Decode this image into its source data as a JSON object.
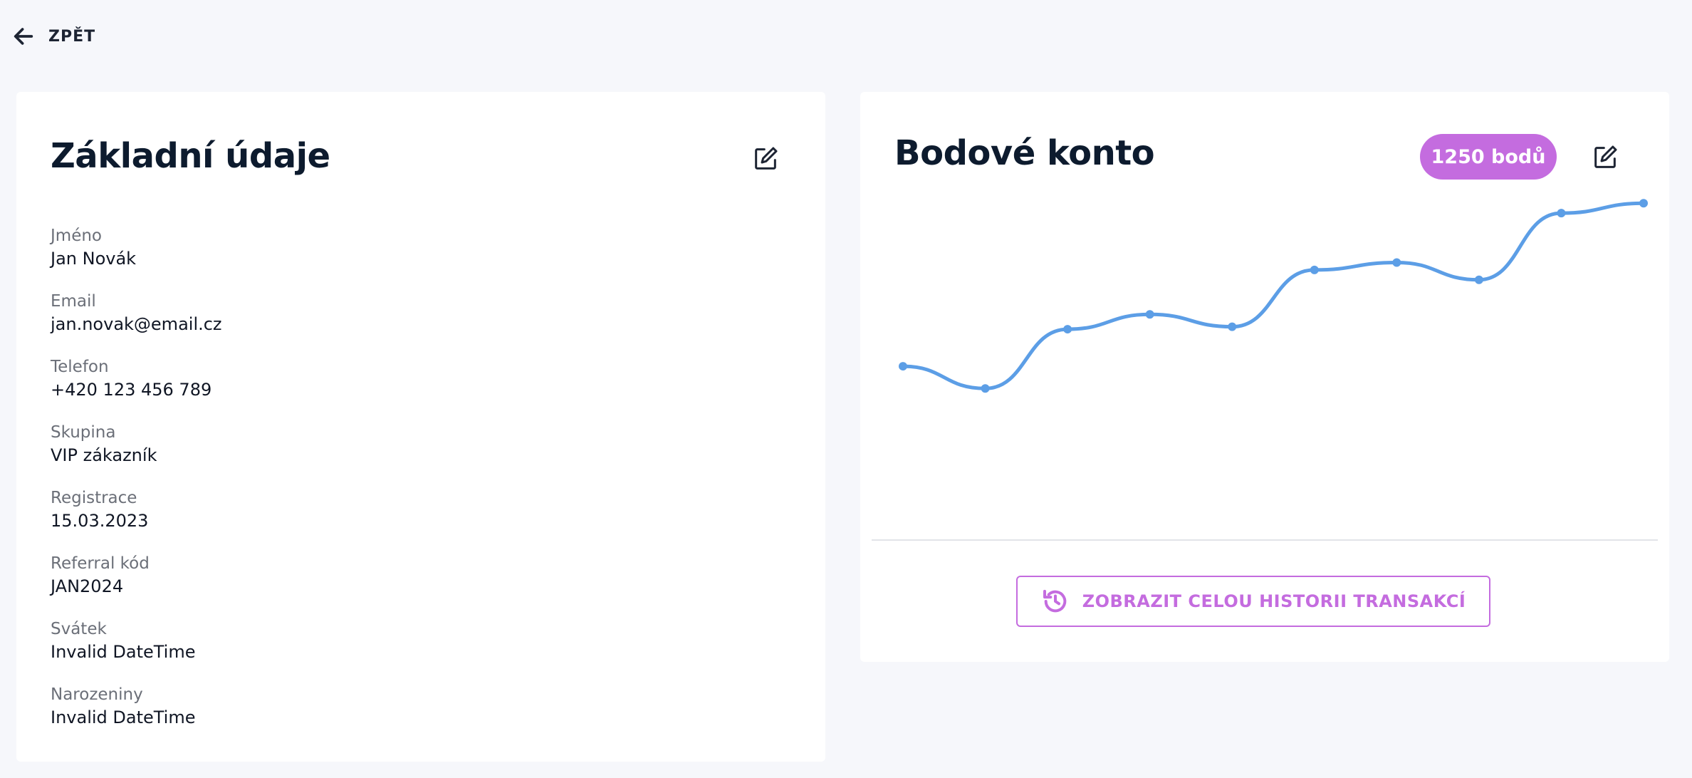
{
  "nav": {
    "back_label": "ZPĚT",
    "back_icon": "arrow-left-icon"
  },
  "basic_info": {
    "title": "Základní údaje",
    "edit_icon": "edit-icon",
    "fields": [
      {
        "label": "Jméno",
        "value": "Jan Novák"
      },
      {
        "label": "Email",
        "value": "jan.novak@email.cz"
      },
      {
        "label": "Telefon",
        "value": "+420 123 456 789"
      },
      {
        "label": "Skupina",
        "value": "VIP zákazník"
      },
      {
        "label": "Registrace",
        "value": "15.03.2023"
      },
      {
        "label": "Referral kód",
        "value": "JAN2024"
      },
      {
        "label": "Svátek",
        "value": "Invalid DateTime"
      },
      {
        "label": "Narozeniny",
        "value": "Invalid DateTime"
      }
    ]
  },
  "points": {
    "title": "Bodové konto",
    "badge": "1250 bodů",
    "edit_icon": "edit-icon",
    "history_button": "ZOBRAZIT CELOU HISTORII TRANSAKCÍ",
    "history_icon": "history-icon"
  },
  "chart_data": {
    "type": "line",
    "series": [
      {
        "values": [
          620,
          530,
          770,
          830,
          780,
          1010,
          1040,
          970,
          1240,
          1280
        ]
      }
    ],
    "ylim": [
      0,
      1500
    ],
    "grid": false,
    "color": "#5c9ee6"
  },
  "colors": {
    "accent": "#c46cdf",
    "line": "#5c9ee6",
    "background": "#f6f7fb"
  }
}
